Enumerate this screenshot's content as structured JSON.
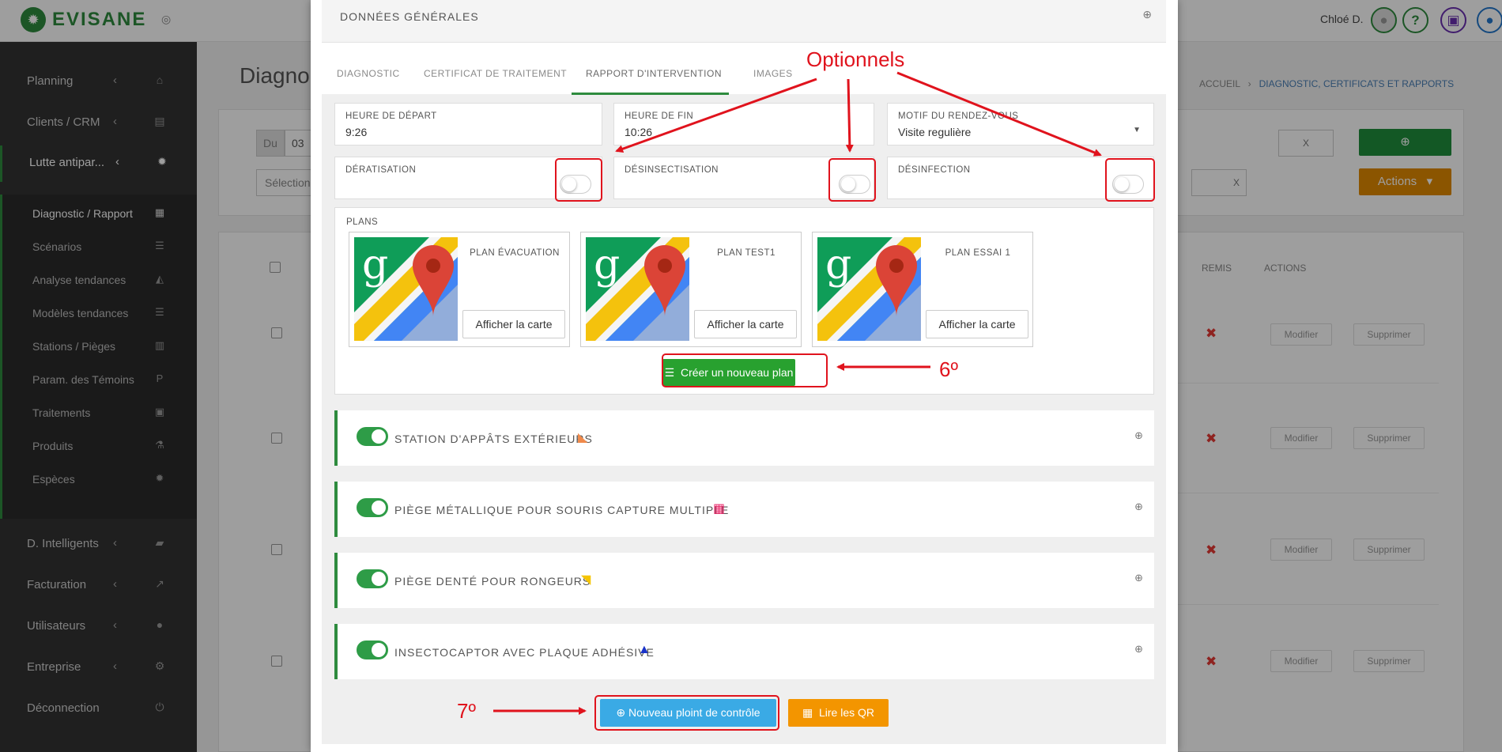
{
  "topbar": {
    "brand": "EVISANE",
    "tagline": "",
    "user_name": "Chloé D.",
    "icons": [
      "user-avatar-icon",
      "help-icon",
      "gift-icon",
      "chat-icon"
    ]
  },
  "sidebar": {
    "items": [
      {
        "label": "Planning",
        "icon": "home-icon"
      },
      {
        "label": "Clients / CRM",
        "icon": "id-card-icon"
      },
      {
        "label": "Lutte antipar...",
        "icon": "bug-icon"
      },
      {
        "label": "D. Intelligents",
        "icon": "folder-open-icon"
      },
      {
        "label": "Facturation",
        "icon": "line-chart-icon"
      },
      {
        "label": "Utilisateurs",
        "icon": "user-icon"
      },
      {
        "label": "Entreprise",
        "icon": "gear-icon"
      },
      {
        "label": "Déconnection",
        "icon": "power-icon"
      }
    ],
    "subitems": [
      {
        "label": "Diagnostic / Rapport",
        "icon": "clipboard-icon"
      },
      {
        "label": "Scénarios",
        "icon": "list-icon"
      },
      {
        "label": "Analyse tendances",
        "icon": "area-chart-icon"
      },
      {
        "label": "Modèles tendances",
        "icon": "list-icon"
      },
      {
        "label": "Stations / Pièges",
        "icon": "trash-icon"
      },
      {
        "label": "Param. des Témoins",
        "icon": "p-icon"
      },
      {
        "label": "Traitements",
        "icon": "medkit-icon"
      },
      {
        "label": "Produits",
        "icon": "flask-icon"
      },
      {
        "label": "Espèces",
        "icon": "bug-icon"
      }
    ]
  },
  "background": {
    "page_title": "Diagno",
    "breadcrumb_home": "ACCUEIL",
    "breadcrumb_current": "DIAGNOSTIC, CERTIFICATS ET RAPPORTS",
    "filter_du": "Du",
    "filter_date": "03",
    "filter_select": "Sélection",
    "clear_x": "X",
    "actions_label": "Actions",
    "col_remis": "REMIS",
    "col_actions": "ACTIONS",
    "modify_label": "Modifier",
    "delete_label": "Supprimer"
  },
  "modal": {
    "general_header": "DONNÉES GÉNÉRALES",
    "tabs": [
      {
        "label": "DIAGNOSTIC"
      },
      {
        "label": "CERTIFICAT DE TRAITEMENT"
      },
      {
        "label": "RAPPORT D'INTERVENTION"
      },
      {
        "label": "IMAGES"
      }
    ],
    "active_tab": "RAPPORT D'INTERVENTION",
    "fields": {
      "start_label": "HEURE DE DÉPART",
      "start_value": "9:26",
      "end_label": "HEURE DE FIN",
      "end_value": "10:26",
      "reason_label": "MOTIF DU RENDEZ-VOUS",
      "reason_value": "Visite regulière"
    },
    "switches": [
      {
        "label": "DÉRATISATION",
        "on": false
      },
      {
        "label": "DÉSINSECTISATION",
        "on": false
      },
      {
        "label": "DÉSINFECTION",
        "on": false
      }
    ],
    "plans_label": "PLANS",
    "plans": [
      {
        "name": "PLAN ÉVACUATION",
        "button": "Afficher la carte"
      },
      {
        "name": "PLAN TEST1",
        "button": "Afficher la carte"
      },
      {
        "name": "PLAN ESSAI 1",
        "button": "Afficher la carte"
      }
    ],
    "new_plan_button": "Créer un nouveau plan",
    "sections": [
      {
        "title": "STATION D'APPÂTS EXTÉRIEURS",
        "on": true,
        "icon": "bait-station-icon",
        "icon_color": "#f08a4b"
      },
      {
        "title": "PIÈGE MÉTALLIQUE POUR SOURIS CAPTURE MULTIPLE",
        "on": true,
        "icon": "metal-trap-icon",
        "icon_color": "#e91e63"
      },
      {
        "title": "PIÈGE DENTÉ POUR RONGEURS",
        "on": true,
        "icon": "snap-trap-icon",
        "icon_color": "#f5c400"
      },
      {
        "title": "INSECTOCAPTOR AVEC PLAQUE ADHÉSIVE",
        "on": true,
        "icon": "insect-trap-icon",
        "icon_color": "#1a33c9"
      }
    ],
    "new_point_button": "Nouveau ploint de contrôle",
    "read_qr_button": "Lire les QR"
  },
  "annotations": {
    "optional_label": "Optionnels",
    "step6": "6º",
    "step7": "7º"
  },
  "colors": {
    "brand_green": "#2e8b3e",
    "annotation_red": "#e0131d",
    "blue_button": "#3aaae5",
    "orange_button": "#f39500"
  }
}
